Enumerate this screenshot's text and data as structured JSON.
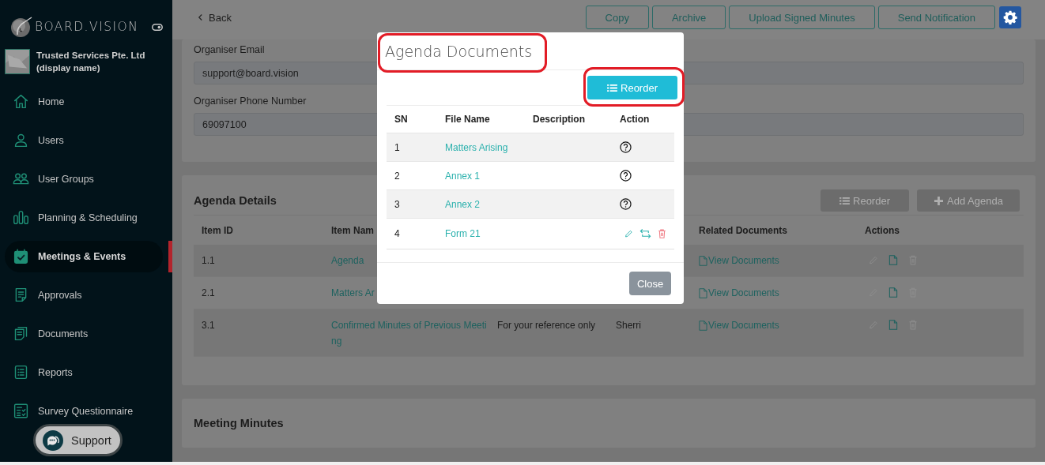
{
  "sidebar": {
    "brand": "BOARD.VISION",
    "organisation": "Trusted Services Pte. Ltd (display name)",
    "items": [
      {
        "label": "Home",
        "selected": false
      },
      {
        "label": "Users",
        "selected": false
      },
      {
        "label": "User Groups",
        "selected": false
      },
      {
        "label": "Planning & Scheduling",
        "selected": false
      },
      {
        "label": "Meetings & Events",
        "selected": true
      },
      {
        "label": "Approvals",
        "selected": false
      },
      {
        "label": "Documents",
        "selected": false
      },
      {
        "label": "Reports",
        "selected": false
      },
      {
        "label": "Survey Questionnaire",
        "selected": false
      }
    ],
    "support_button": "Support"
  },
  "topbar": {
    "back": "Back",
    "buttons": [
      "Copy",
      "Archive",
      "Upload Signed Minutes",
      "Send Notification"
    ]
  },
  "organiser": {
    "fields": [
      {
        "label": "Organiser Email",
        "value": "support@board.vision"
      },
      {
        "label": "Organiser Phone Number",
        "value": "69097100"
      }
    ]
  },
  "agenda_details": {
    "title": "Agenda Details",
    "buttons": [
      {
        "label": "Reorder",
        "kind": "list",
        "disabled": true
      },
      {
        "label": "Add Agenda",
        "kind": "plus",
        "disabled": true
      }
    ],
    "columns": [
      "Item ID",
      "Item Nam",
      "Related Documents",
      "Actions"
    ],
    "rows": [
      {
        "item_id": "1.1",
        "item_name": "Agenda",
        "related": "View Documents",
        "editable": false
      },
      {
        "item_id": "2.1",
        "item_name": "Matters Ar",
        "related": "View Documents",
        "editable": false
      },
      {
        "item_id": "3.1",
        "item_name": "Confirmed Minutes of Previous Meeting",
        "description": "For your reference only",
        "column_4": "Sherri",
        "related": "View Documents",
        "editable": false
      }
    ]
  },
  "meeting_minutes": {
    "title": "Meeting Minutes"
  },
  "modal": {
    "title": "Agenda Documents",
    "title_highlighted": true,
    "reorder_button": {
      "label": "Reorder",
      "highlighted": true
    },
    "columns": [
      "SN",
      "File Name",
      "Description",
      "Action"
    ],
    "rows": [
      {
        "sn": "1",
        "file_name": "Matters Arising",
        "kind": "help"
      },
      {
        "sn": "2",
        "file_name": "Annex 1",
        "kind": "help"
      },
      {
        "sn": "3",
        "file_name": "Annex 2",
        "kind": "help"
      },
      {
        "sn": "4",
        "file_name": "Form 21",
        "kind": "edit"
      }
    ],
    "close_button": "Close"
  }
}
